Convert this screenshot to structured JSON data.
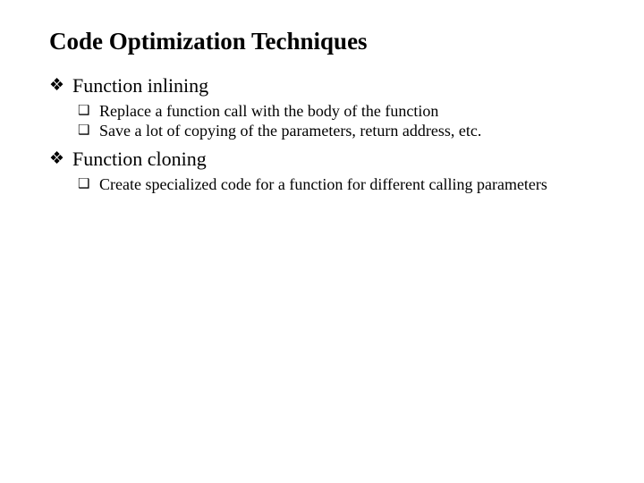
{
  "title": "Code Optimization Techniques",
  "bullets": {
    "b1": {
      "label": "Function inlining",
      "sub1": "Replace a function call with the body of the function",
      "sub2": "Save a lot of copying of the parameters, return address, etc."
    },
    "b2": {
      "label": "Function cloning",
      "sub1": "Create specialized code for a function for different calling parameters"
    }
  },
  "glyphs": {
    "diamond": "❖",
    "square": "❑"
  }
}
